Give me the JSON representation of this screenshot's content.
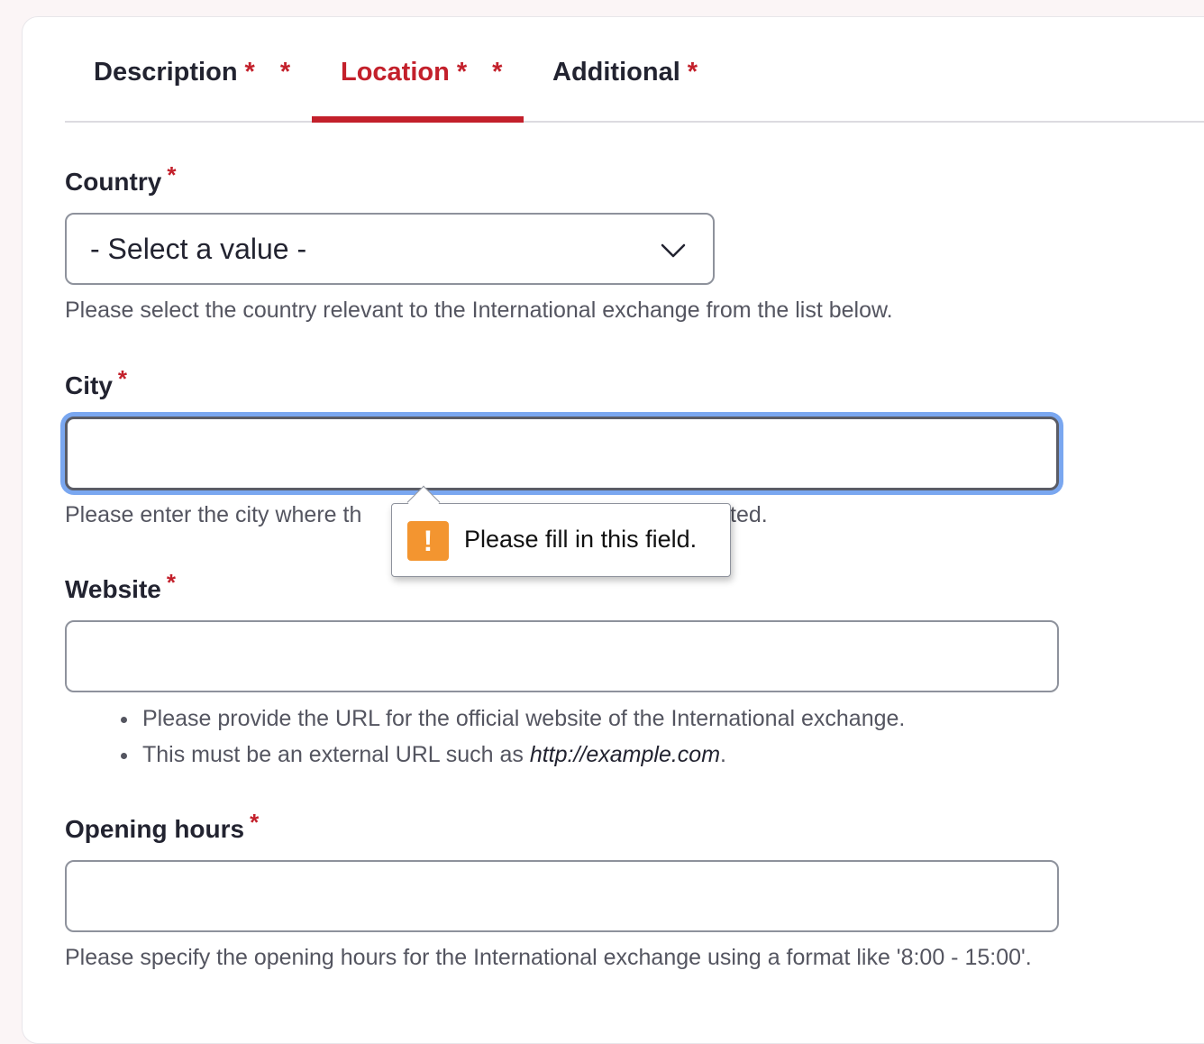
{
  "tabs": [
    {
      "label": "Description",
      "stars": "* *",
      "active": false
    },
    {
      "label": "Location",
      "stars": "* *",
      "active": true
    },
    {
      "label": "Additional",
      "stars": "*",
      "active": false
    }
  ],
  "required_marker": "*",
  "fields": {
    "country": {
      "label": "Country",
      "selected_value": "- Select a value -",
      "help": "Please select the country relevant to the International exchange from the list below."
    },
    "city": {
      "label": "City",
      "value": "",
      "help_visible_start": "Please enter the city where th",
      "help_visible_end": "ted."
    },
    "website": {
      "label": "Website",
      "value": "",
      "help_bullet_1": "Please provide the URL for the official website of the International exchange.",
      "help_bullet_2_prefix": "This must be an external URL such as ",
      "help_bullet_2_example": "http://example.com",
      "help_bullet_2_suffix": "."
    },
    "opening_hours": {
      "label": "Opening hours",
      "value": "",
      "help": "Please specify the opening hours for the International exchange using a format like '8:00 - 15:00'."
    }
  },
  "validation_tooltip": {
    "icon": "warning-icon",
    "icon_glyph": "!",
    "message": "Please fill in this field."
  },
  "colors": {
    "accent": "#c3202b",
    "focus_ring": "#7aa7f0",
    "warning": "#f39530"
  }
}
